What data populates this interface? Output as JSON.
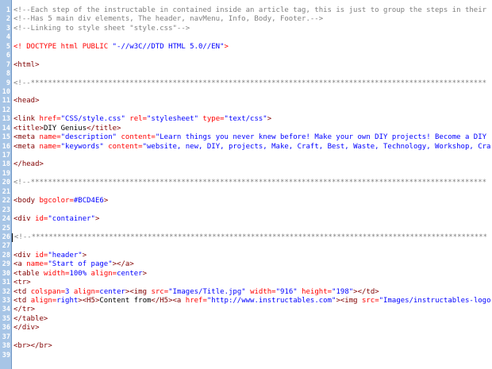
{
  "editor": {
    "lines": [
      {
        "n": "1",
        "parts": [
          {
            "t": "c",
            "v": "<!--Each step of the instructable in contained inside an article tag, this is just to group the steps in their"
          }
        ]
      },
      {
        "n": "2",
        "parts": [
          {
            "t": "c",
            "v": "<!--Has 5 main div elements, The header, navMenu, Info, Body, Footer.-->"
          }
        ]
      },
      {
        "n": "3",
        "parts": [
          {
            "t": "c",
            "v": "<!--Linking to style sheet \"style.css\"-->"
          }
        ]
      },
      {
        "n": "4",
        "parts": []
      },
      {
        "n": "5",
        "parts": [
          {
            "t": "d",
            "v": "<! DOCTYPE html PUBLIC "
          },
          {
            "t": "ds",
            "v": "\"-//w3C//DTD HTML 5.0//EN\""
          },
          {
            "t": "d",
            "v": ">"
          }
        ]
      },
      {
        "n": "6",
        "parts": []
      },
      {
        "n": "7",
        "parts": [
          {
            "t": "g",
            "v": "<html>"
          }
        ]
      },
      {
        "n": "8",
        "parts": []
      },
      {
        "n": "9",
        "parts": [
          {
            "t": "c",
            "v": "<!--**********************************************************************************************************"
          }
        ]
      },
      {
        "n": "10",
        "parts": []
      },
      {
        "n": "11",
        "parts": [
          {
            "t": "g",
            "v": "<head>"
          }
        ]
      },
      {
        "n": "12",
        "parts": []
      },
      {
        "n": "13",
        "parts": [
          {
            "t": "g",
            "v": "<link "
          },
          {
            "t": "a",
            "v": "href="
          },
          {
            "t": "s",
            "v": "\"CSS/style.css\""
          },
          {
            "t": "a",
            "v": " rel="
          },
          {
            "t": "s",
            "v": "\"stylesheet\""
          },
          {
            "t": "a",
            "v": " type="
          },
          {
            "t": "s",
            "v": "\"text/css\""
          },
          {
            "t": "g",
            "v": ">"
          }
        ]
      },
      {
        "n": "14",
        "parts": [
          {
            "t": "g",
            "v": "<title>"
          },
          {
            "t": "x",
            "v": "DIY Genius"
          },
          {
            "t": "g",
            "v": "</title>"
          }
        ]
      },
      {
        "n": "15",
        "parts": [
          {
            "t": "g",
            "v": "<meta "
          },
          {
            "t": "a",
            "v": "name="
          },
          {
            "t": "s",
            "v": "\"description\""
          },
          {
            "t": "a",
            "v": " content="
          },
          {
            "t": "s",
            "v": "\"Learn things you never knew before! Make your own DIY projects! Become a DIY"
          }
        ]
      },
      {
        "n": "16",
        "parts": [
          {
            "t": "g",
            "v": "<meta "
          },
          {
            "t": "a",
            "v": "name="
          },
          {
            "t": "s",
            "v": "\"keywords\""
          },
          {
            "t": "a",
            "v": " content="
          },
          {
            "t": "s",
            "v": "\"website, new, DIY, projects, Make, Craft, Best, Waste, Technology, Workshop, Cra"
          }
        ]
      },
      {
        "n": "17",
        "parts": []
      },
      {
        "n": "18",
        "parts": [
          {
            "t": "g",
            "v": "</head>"
          }
        ]
      },
      {
        "n": "19",
        "parts": []
      },
      {
        "n": "20",
        "parts": [
          {
            "t": "c",
            "v": "<!--**********************************************************************************************************"
          }
        ]
      },
      {
        "n": "21",
        "parts": []
      },
      {
        "n": "22",
        "parts": [
          {
            "t": "g",
            "v": "<body "
          },
          {
            "t": "a",
            "v": "bgcolor="
          },
          {
            "t": "s",
            "v": "#BCD4E6"
          },
          {
            "t": "g",
            "v": ">"
          }
        ]
      },
      {
        "n": "23",
        "parts": []
      },
      {
        "n": "24",
        "parts": [
          {
            "t": "g",
            "v": "<div "
          },
          {
            "t": "a",
            "v": "id="
          },
          {
            "t": "s",
            "v": "\"container\""
          },
          {
            "t": "g",
            "v": ">"
          }
        ]
      },
      {
        "n": "25",
        "parts": []
      },
      {
        "n": "26",
        "cursor": true,
        "parts": [
          {
            "t": "c",
            "v": "<!--**********************************************************************************************************"
          }
        ]
      },
      {
        "n": "27",
        "parts": []
      },
      {
        "n": "28",
        "parts": [
          {
            "t": "g",
            "v": "<div "
          },
          {
            "t": "a",
            "v": "id="
          },
          {
            "t": "s",
            "v": "\"header\""
          },
          {
            "t": "g",
            "v": ">"
          }
        ]
      },
      {
        "n": "29",
        "parts": [
          {
            "t": "g",
            "v": "<a "
          },
          {
            "t": "a",
            "v": "name="
          },
          {
            "t": "s",
            "v": "\"Start of page\""
          },
          {
            "t": "g",
            "v": "></a>"
          }
        ]
      },
      {
        "n": "30",
        "parts": [
          {
            "t": "g",
            "v": "<table "
          },
          {
            "t": "a",
            "v": "width="
          },
          {
            "t": "s",
            "v": "100%"
          },
          {
            "t": "a",
            "v": " align="
          },
          {
            "t": "s",
            "v": "center"
          },
          {
            "t": "g",
            "v": ">"
          }
        ]
      },
      {
        "n": "31",
        "parts": [
          {
            "t": "g",
            "v": "<tr>"
          }
        ]
      },
      {
        "n": "32",
        "parts": [
          {
            "t": "g",
            "v": "<td "
          },
          {
            "t": "a",
            "v": "colspan="
          },
          {
            "t": "s",
            "v": "3"
          },
          {
            "t": "a",
            "v": " align="
          },
          {
            "t": "s",
            "v": "center"
          },
          {
            "t": "g",
            "v": "><img "
          },
          {
            "t": "a",
            "v": "src="
          },
          {
            "t": "s",
            "v": "\"Images/Title.jpg\""
          },
          {
            "t": "a",
            "v": " width="
          },
          {
            "t": "s",
            "v": "\"916\""
          },
          {
            "t": "a",
            "v": " height="
          },
          {
            "t": "s",
            "v": "\"198\""
          },
          {
            "t": "g",
            "v": "></td>"
          }
        ]
      },
      {
        "n": "33",
        "parts": [
          {
            "t": "g",
            "v": "<td "
          },
          {
            "t": "a",
            "v": "align="
          },
          {
            "t": "s",
            "v": "right"
          },
          {
            "t": "g",
            "v": "><H5>"
          },
          {
            "t": "x",
            "v": "Content from"
          },
          {
            "t": "g",
            "v": "</H5><a "
          },
          {
            "t": "a",
            "v": "href="
          },
          {
            "t": "s",
            "v": "\"http://www.instructables.com\""
          },
          {
            "t": "g",
            "v": "><img "
          },
          {
            "t": "a",
            "v": "src="
          },
          {
            "t": "s",
            "v": "\"Images/instructables-logo"
          }
        ]
      },
      {
        "n": "34",
        "parts": [
          {
            "t": "g",
            "v": "</tr>"
          }
        ]
      },
      {
        "n": "35",
        "parts": [
          {
            "t": "g",
            "v": "</table>"
          }
        ]
      },
      {
        "n": "36",
        "parts": [
          {
            "t": "g",
            "v": "</div>"
          }
        ]
      },
      {
        "n": "37",
        "parts": []
      },
      {
        "n": "38",
        "parts": [
          {
            "t": "g",
            "v": "<br></br>"
          }
        ]
      },
      {
        "n": "39",
        "parts": []
      }
    ]
  }
}
